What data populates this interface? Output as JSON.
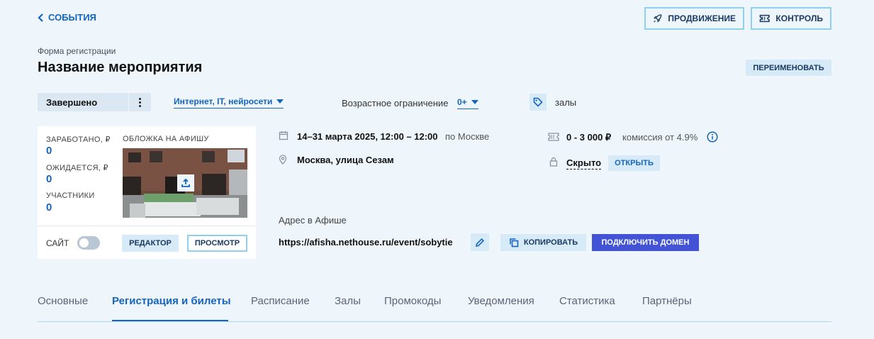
{
  "header": {
    "back_label": "СОБЫТИЯ",
    "promo_label": "ПРОДВИЖЕНИЕ",
    "control_label": "КОНТРОЛЬ"
  },
  "event": {
    "form_label": "Форма регистрации",
    "title": "Название мероприятия",
    "rename_label": "ПЕРЕИМЕНОВАТЬ",
    "status": "Завершено",
    "category": "Интернет, IT, нейросети",
    "age_label": "Возрастное ограничение",
    "age_value": "0+",
    "tag_text": "залы"
  },
  "card": {
    "earned_label": "ЗАРАБОТАНО, ₽",
    "earned_value": "0",
    "expected_label": "ОЖИДАЕТСЯ, ₽",
    "expected_value": "0",
    "participants_label": "УЧАСТНИКИ",
    "participants_value": "0",
    "cover_label": "ОБЛОЖКА НА АФИШУ",
    "site_label": "САЙТ",
    "site_enabled": false,
    "editor_label": "РЕДАКТОР",
    "preview_label": "ПРОСМОТР"
  },
  "details": {
    "date": "14–31 марта 2025, 12:00 – 12:00",
    "timezone": "по Москве",
    "place": "Москва, улица Сезам",
    "price": "0 - 3 000 ₽",
    "commission": "комиссия от 4.9%",
    "visibility": "Скрыто",
    "open_label": "ОТКРЫТЬ",
    "address_label": "Адрес в Афише",
    "url": "https://afisha.nethouse.ru/event/sobytie",
    "copy_label": "КОПИРОВАТЬ",
    "domain_label": "ПОДКЛЮЧИТЬ ДОМЕН"
  },
  "tabs": [
    {
      "label": "Основные",
      "active": false
    },
    {
      "label": "Регистрация и билеты",
      "active": true
    },
    {
      "label": "Расписание",
      "active": false
    },
    {
      "label": "Залы",
      "active": false
    },
    {
      "label": "Промокоды",
      "active": false
    },
    {
      "label": "Уведомления",
      "active": false
    },
    {
      "label": "Статистика",
      "active": false
    },
    {
      "label": "Партнёры",
      "active": false
    }
  ],
  "colors": {
    "background": "#eef6fc",
    "accent": "#1565c0",
    "primary_button": "#4353d6",
    "light_button": "#d7eaf8"
  }
}
